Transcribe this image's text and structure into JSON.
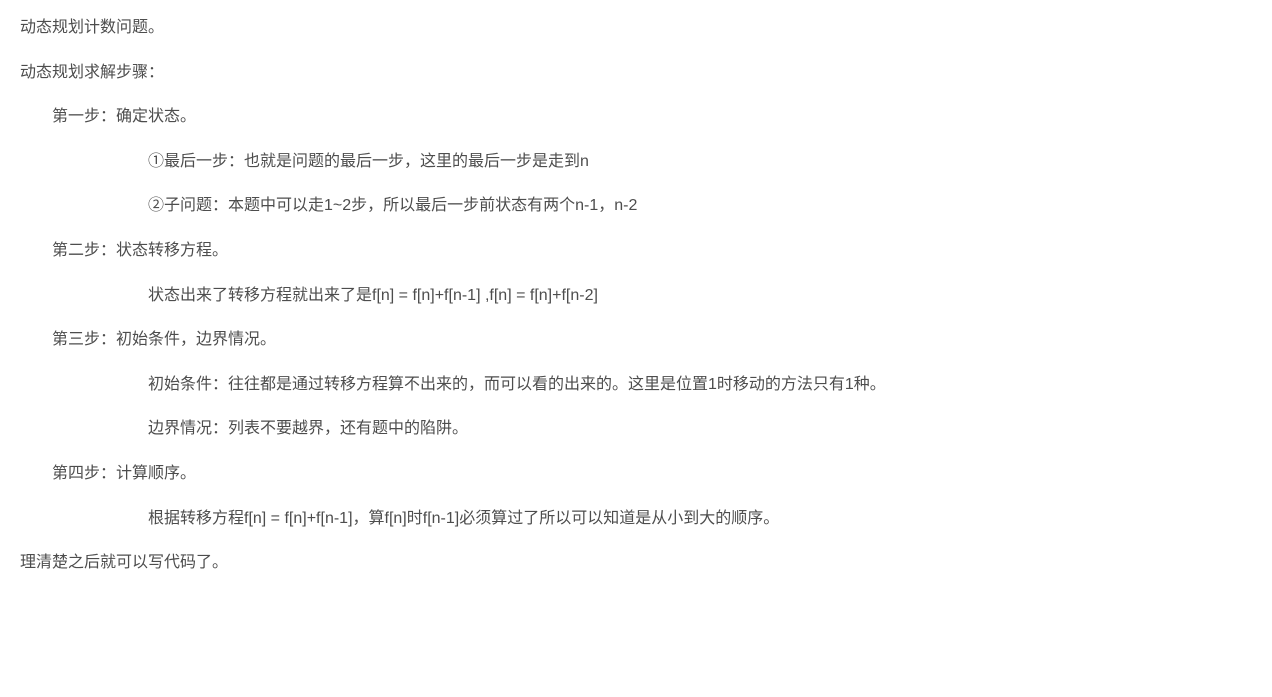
{
  "p1": "动态规划计数问题。",
  "p2": "动态规划求解步骤：",
  "step1": {
    "title": "第一步：确定状态。",
    "line1": "①最后一步：也就是问题的最后一步，这里的最后一步是走到n",
    "line2": "②子问题：本题中可以走1~2步，所以最后一步前状态有两个n-1，n-2"
  },
  "step2": {
    "title": "第二步：状态转移方程。",
    "line1": "状态出来了转移方程就出来了是f[n] = f[n]+f[n-1]  ,f[n] = f[n]+f[n-2]"
  },
  "step3": {
    "title": "第三步：初始条件，边界情况。",
    "line1": "初始条件：往往都是通过转移方程算不出来的，而可以看的出来的。这里是位置1时移动的方法只有1种。",
    "line2": "边界情况：列表不要越界，还有题中的陷阱。"
  },
  "step4": {
    "title": "第四步：计算顺序。",
    "line1": "根据转移方程f[n] = f[n]+f[n-1]，算f[n]时f[n-1]必须算过了所以可以知道是从小到大的顺序。"
  },
  "p_last": "理清楚之后就可以写代码了。"
}
